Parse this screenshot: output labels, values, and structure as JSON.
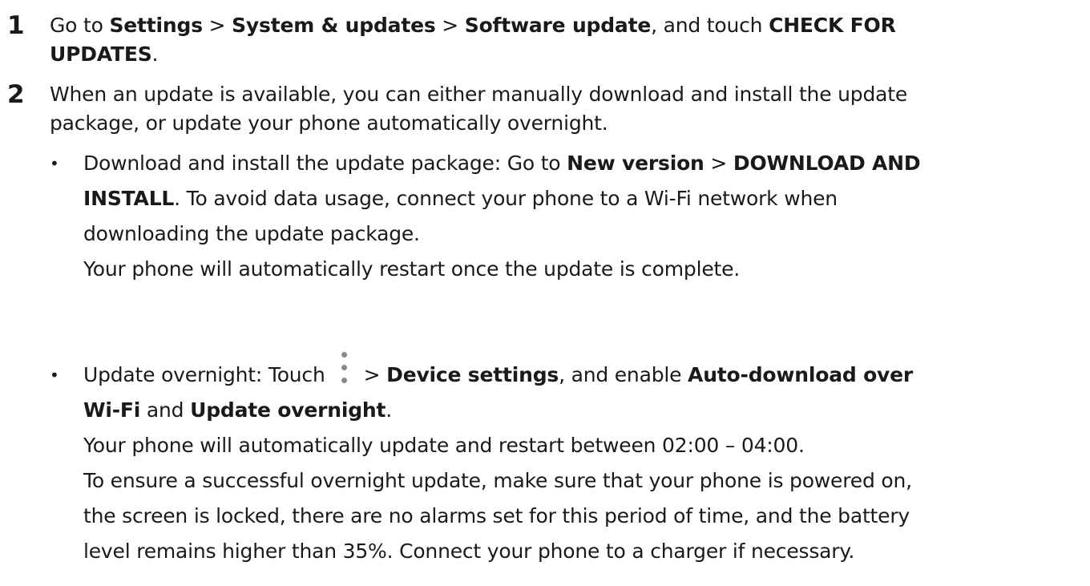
{
  "step1": {
    "number": "1",
    "lines": [
      [
        "Go to ",
        "Settings",
        " > ",
        "System & updates",
        " > ",
        "Software update",
        ", and touch ",
        "CHECK FOR"
      ],
      [
        "UPDATES",
        "."
      ]
    ]
  },
  "step2": {
    "number": "2",
    "line1": "When an update is available, you can either manually download and install the update",
    "line2": "package, or update your phone automatically overnight."
  },
  "bullet1": {
    "dot": "•",
    "l1_a": "Download and install the update package: Go to ",
    "l1_b": "New version",
    "l1_c": " > ",
    "l1_d": "DOWNLOAD AND",
    "l2_a": "INSTALL",
    "l2_b": ". To avoid data usage, connect your phone to a Wi-Fi network when",
    "l3": "downloading the update package.",
    "l4": "Your phone will automatically restart once the update is complete."
  },
  "bullet2": {
    "dot": "•",
    "icon": "more-vertical-icon",
    "l1_a": "Update overnight: Touch",
    "l1_b": "> ",
    "l1_c": "Device settings",
    "l1_d": ", and enable ",
    "l1_e": "Auto-download over",
    "l2_a": "Wi-Fi",
    "l2_b": " and ",
    "l2_c": "Update overnight",
    "l2_d": ".",
    "l3": "Your phone will automatically update and restart between 02:00 – 04:00.",
    "l4": "To ensure a successful overnight update, make sure that your phone is powered on,",
    "l5": "the screen is locked, there are no alarms set for this period of time, and the battery",
    "l6": "level remains higher than 35%. Connect your phone to a charger if necessary."
  }
}
